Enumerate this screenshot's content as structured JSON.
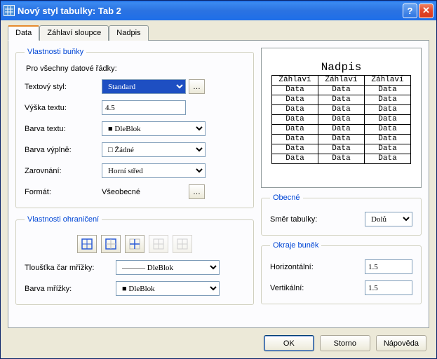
{
  "title": "Nový styl tabulky: Tab 2",
  "tabs": {
    "data": "Data",
    "header": "Záhlaví sloupce",
    "title_tab": "Nadpis"
  },
  "cellprops": {
    "legend": "Vlastnosti buňky",
    "allrows": "Pro všechny datové řádky:",
    "textstyle_lbl": "Textový styl:",
    "textstyle_val": "Standard",
    "textheight_lbl": "Výška textu:",
    "textheight_val": "4.5",
    "textcolor_lbl": "Barva textu:",
    "textcolor_val": "DleBlok",
    "fillcolor_lbl": "Barva výplně:",
    "fillcolor_val": "Žádné",
    "align_lbl": "Zarovnání:",
    "align_val": "Horní střed",
    "format_lbl": "Formát:",
    "format_val": "Všeobecné"
  },
  "borderprops": {
    "legend": "Vlastnosti ohraničení",
    "linew_lbl": "Tloušťka čar mřížky:",
    "linew_val": "DleBlok",
    "gridcolor_lbl": "Barva mřížky:",
    "gridcolor_val": "DleBlok"
  },
  "preview": {
    "caption": "Nadpis",
    "header": "Záhlaví",
    "cell": "Data",
    "rows": 8,
    "cols": 3
  },
  "general": {
    "legend": "Obecné",
    "dir_lbl": "Směr tabulky:",
    "dir_val": "Dolů"
  },
  "margins": {
    "legend": "Okraje buněk",
    "h_lbl": "Horizontální:",
    "h_val": "1.5",
    "v_lbl": "Vertikální:",
    "v_val": "1.5"
  },
  "buttons": {
    "ok": "OK",
    "cancel": "Storno",
    "help": "Nápověda"
  }
}
